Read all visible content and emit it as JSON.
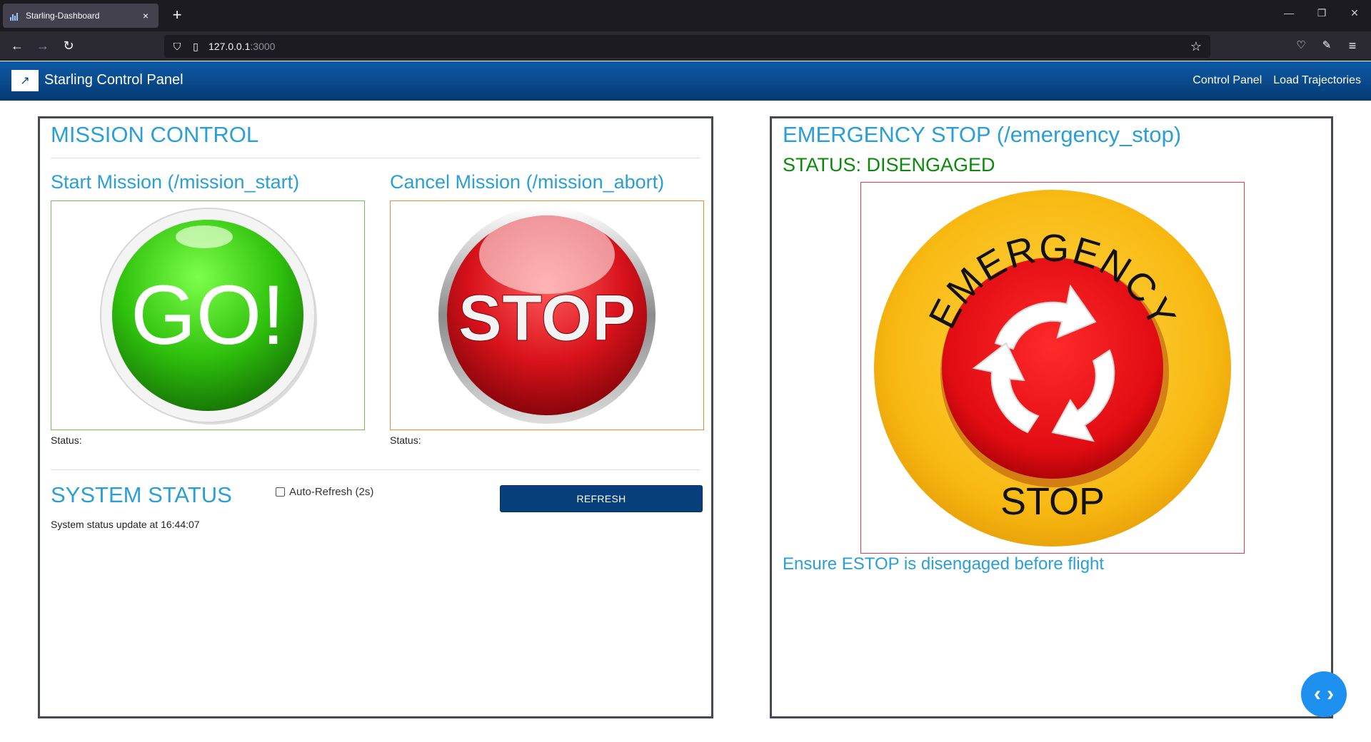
{
  "browser": {
    "tab_title": "Starling-Dashboard",
    "tab_close": "×",
    "new_tab": "+",
    "url_host": "127.0.0.1",
    "url_port": ":3000",
    "icons": [
      "back-icon",
      "forward-icon",
      "reload-icon",
      "shield-icon",
      "page-icon",
      "star-icon",
      "pocket-icon",
      "wrench-icon",
      "menu-icon"
    ]
  },
  "app": {
    "brand": "Starling Control Panel",
    "nav": [
      "Control Panel",
      "Load Trajectories"
    ]
  },
  "mission": {
    "title": "MISSION CONTROL",
    "start_title": "Start Mission (/mission_start)",
    "start_button_text": "GO!",
    "start_status": "Status:",
    "cancel_title": "Cancel Mission (/mission_abort)",
    "cancel_button_text": "STOP",
    "cancel_status": "Status:"
  },
  "system": {
    "title": "SYSTEM STATUS",
    "auto_refresh_label": "Auto-Refresh (2s)",
    "auto_refresh_checked": false,
    "refresh_label": "REFRESH",
    "status_text": "System status update at 16:44:07"
  },
  "estop": {
    "title": "EMERGENCY STOP (/emergency_stop)",
    "status": "STATUS: DISENGAGED",
    "arc_top": "EMERGENCY",
    "arc_bottom": "STOP",
    "note": "Ensure ESTOP is disengaged before flight"
  },
  "colors": {
    "accent": "#2a9fd6",
    "header_top": "#0d5aa7",
    "header_bottom": "#063a72",
    "go_green": "#2fc10d",
    "stop_red": "#d8121b",
    "estop_yellow": "#f8b811",
    "status_green": "#0a8a0a"
  }
}
